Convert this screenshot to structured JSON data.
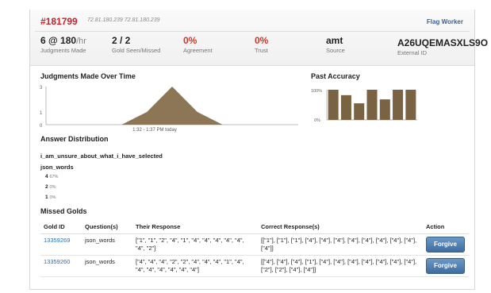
{
  "header": {
    "worker_id": "#181799",
    "ips": "72.81.180.239 72.81.180.239",
    "flag_label": "Flag Worker",
    "stats": [
      {
        "value": "6 @ 180",
        "unit": "/hr",
        "label": "Judgments Made"
      },
      {
        "value": "2 / 2",
        "label": "Gold Seen/Missed"
      },
      {
        "value": "0%",
        "label": "Agreement"
      },
      {
        "value": "0%",
        "label": "Trust"
      },
      {
        "value": "amt",
        "label": "Source"
      },
      {
        "value": "A26UQEMASXLS9O",
        "label": "External ID"
      }
    ]
  },
  "chart_data": [
    {
      "type": "area",
      "title": "Judgments Made Over Time",
      "xlabel": "1:32 - 1:37 PM today",
      "y_ticks": [
        "3",
        "1",
        "0"
      ],
      "ylim": [
        0,
        3
      ],
      "x": [
        0,
        1,
        2,
        3,
        4,
        5,
        6,
        7,
        8,
        9,
        10
      ],
      "values": [
        0,
        0,
        0,
        0,
        1,
        3,
        1,
        0,
        0,
        0,
        0
      ],
      "colors": {
        "fill": "#8c7656"
      }
    },
    {
      "type": "bar",
      "title": "Past Accuracy",
      "y_ticks": [
        "100%",
        "0%"
      ],
      "ylim": [
        0,
        100
      ],
      "values": [
        100,
        82,
        55,
        100,
        68,
        100,
        100
      ],
      "colors": {
        "fill": "#7a6342"
      }
    }
  ],
  "answers": {
    "title": "Answer Distribution",
    "question1": "i_am_unsure_about_what_i_have_selected",
    "question2": "json_words",
    "rows": [
      {
        "value": "4",
        "pct": "67%"
      },
      {
        "value": "2",
        "pct": "0%"
      },
      {
        "value": "1",
        "pct": "0%"
      }
    ]
  },
  "missed": {
    "title": "Missed Golds",
    "headers": [
      "Gold ID",
      "Question(s)",
      "Their Response",
      "Correct Response(s)",
      "Action"
    ],
    "rows": [
      {
        "gold_id": "13359269",
        "question": "json_words",
        "their": "[\"1\", \"1\", \"2\", \"4\", \"1\", \"4\", \"4\", \"4\", \"4\", \"4\", \"4\", \"2\"]",
        "correct": "[[\"1\"], [\"1\"], [\"1\"], [\"4\"], [\"4\"], [\"4\"], [\"4\"], [\"4\"], [\"4\"], [\"4\"], [\"4\"], [\"4\"]]",
        "action": "Forgive"
      },
      {
        "gold_id": "13359260",
        "question": "json_words",
        "their": "[\"4\", \"4\", \"4\", \"2\", \"2\", \"4\", \"4\", \"4\", \"1\", \"4\", \"4\", \"4\", \"4\", \"4\", \"4\", \"4\"]",
        "correct": "[[\"4\"], [\"4\"], [\"4\"], [\"1\"], [\"4\"], [\"4\"], [\"4\"], [\"4\"], [\"4\"], [\"4\"], [\"4\"], [\"2\"], [\"2\"], [\"4\"], [\"4\"]]",
        "action": "Forgive"
      }
    ]
  },
  "colors": {
    "accent": "#c0242c",
    "link": "#2e6ea6",
    "button": "#4a78a8"
  }
}
